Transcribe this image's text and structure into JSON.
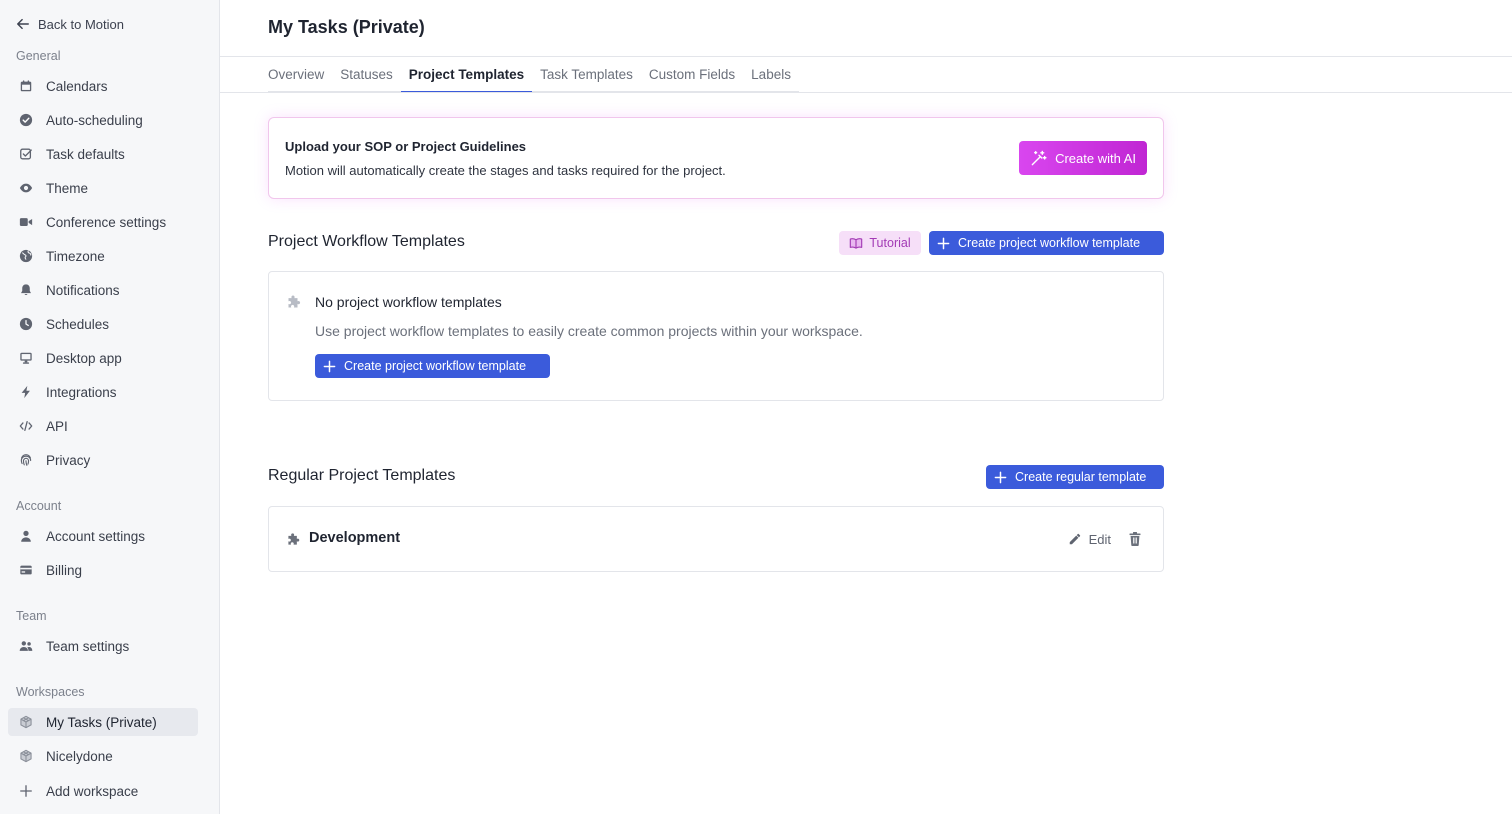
{
  "sidebar": {
    "back_label": "Back to Motion",
    "sections": {
      "general": "General",
      "account": "Account",
      "team": "Team",
      "workspaces": "Workspaces"
    },
    "general_items": [
      {
        "label": "Calendars",
        "icon": "calendar-icon"
      },
      {
        "label": "Auto-scheduling",
        "icon": "check-circle-icon"
      },
      {
        "label": "Task defaults",
        "icon": "checkbox-icon"
      },
      {
        "label": "Theme",
        "icon": "eye-icon"
      },
      {
        "label": "Conference settings",
        "icon": "video-icon"
      },
      {
        "label": "Timezone",
        "icon": "globe-icon"
      },
      {
        "label": "Notifications",
        "icon": "bell-icon"
      },
      {
        "label": "Schedules",
        "icon": "clock-icon"
      },
      {
        "label": "Desktop app",
        "icon": "monitor-icon"
      },
      {
        "label": "Integrations",
        "icon": "bolt-icon"
      },
      {
        "label": "API",
        "icon": "code-icon"
      },
      {
        "label": "Privacy",
        "icon": "fingerprint-icon"
      }
    ],
    "account_items": [
      {
        "label": "Account settings",
        "icon": "user-icon"
      },
      {
        "label": "Billing",
        "icon": "credit-card-icon"
      }
    ],
    "team_items": [
      {
        "label": "Team settings",
        "icon": "users-icon"
      }
    ],
    "workspace_items": [
      {
        "label": "My Tasks (Private)",
        "icon": "cube-icon",
        "active": true
      },
      {
        "label": "Nicelydone",
        "icon": "cube-icon"
      }
    ],
    "add_workspace_label": "Add workspace"
  },
  "main": {
    "title": "My Tasks (Private)",
    "tabs": [
      "Overview",
      "Statuses",
      "Project Templates",
      "Task Templates",
      "Custom Fields",
      "Labels"
    ],
    "active_tab": "Project Templates",
    "ai_card": {
      "title": "Upload your SOP or Project Guidelines",
      "description": "Motion will automatically create the stages and tasks required for the project.",
      "button_label": "Create with AI"
    },
    "workflow": {
      "title": "Project Workflow Templates",
      "tutorial_label": "Tutorial",
      "create_label": "Create project workflow template",
      "empty_title": "No project workflow templates",
      "empty_description": "Use project workflow templates to easily create common projects within your workspace.",
      "empty_create_label": "Create project workflow template"
    },
    "regular": {
      "title": "Regular Project Templates",
      "create_label": "Create regular template",
      "templates": [
        {
          "name": "Development",
          "edit_label": "Edit"
        }
      ]
    }
  },
  "colors": {
    "accent": "#3b5bdb",
    "ai_gradient_start": "#d946ef",
    "ai_gradient_end": "#c026d3",
    "tutorial_bg": "#f6dff8",
    "tutorial_text": "#a33bb5"
  }
}
